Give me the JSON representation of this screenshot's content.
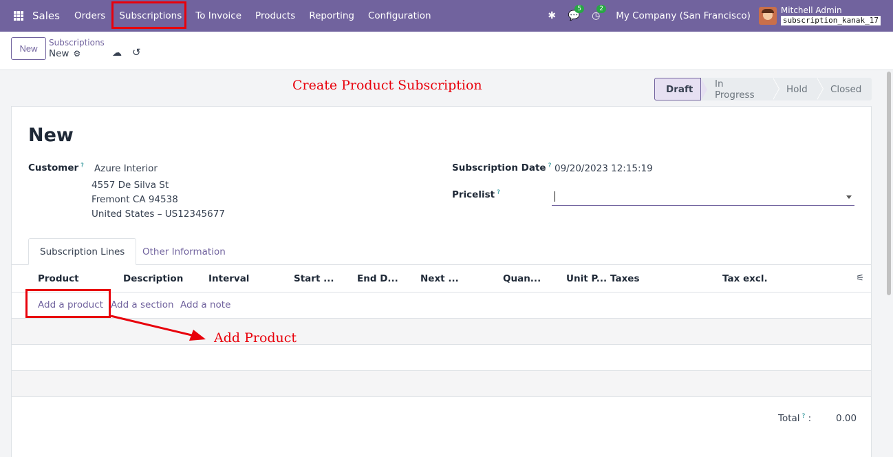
{
  "nav": {
    "brand": "Sales",
    "menu": [
      "Orders",
      "Subscriptions",
      "To Invoice",
      "Products",
      "Reporting",
      "Configuration"
    ],
    "messages_badge": "5",
    "activity_badge": "2",
    "company": "My Company (San Francisco)",
    "user": "Mitchell Admin",
    "database": "subscription_kanak_17"
  },
  "control": {
    "new_button": "New",
    "breadcrumb_parent": "Subscriptions",
    "breadcrumb_current": "New"
  },
  "annotations": {
    "title": "Create Product Subscription",
    "add_product": "Add Product"
  },
  "status": {
    "stages": [
      "Draft",
      "In Progress",
      "Hold",
      "Closed"
    ],
    "current": "Draft"
  },
  "form": {
    "record_title": "New",
    "customer_label": "Customer",
    "customer_name": "Azure Interior",
    "customer_address": [
      "4557 De Silva St",
      "Fremont CA 94538",
      "United States – US12345677"
    ],
    "subscription_date_label": "Subscription Date",
    "subscription_date": "09/20/2023 12:15:19",
    "pricelist_label": "Pricelist",
    "pricelist_value": "",
    "help_mark": "?"
  },
  "tabs": [
    "Subscription Lines",
    "Other Information"
  ],
  "lines": {
    "columns": [
      "Product",
      "Description",
      "Interval",
      "Start ...",
      "End D...",
      "Next ...",
      "Quan...",
      "Unit P...",
      "Taxes",
      "Tax excl."
    ],
    "add_product": "Add a product",
    "add_section": "Add a section",
    "add_note": "Add a note"
  },
  "totals": {
    "label": "Total",
    "value": "0.00"
  }
}
